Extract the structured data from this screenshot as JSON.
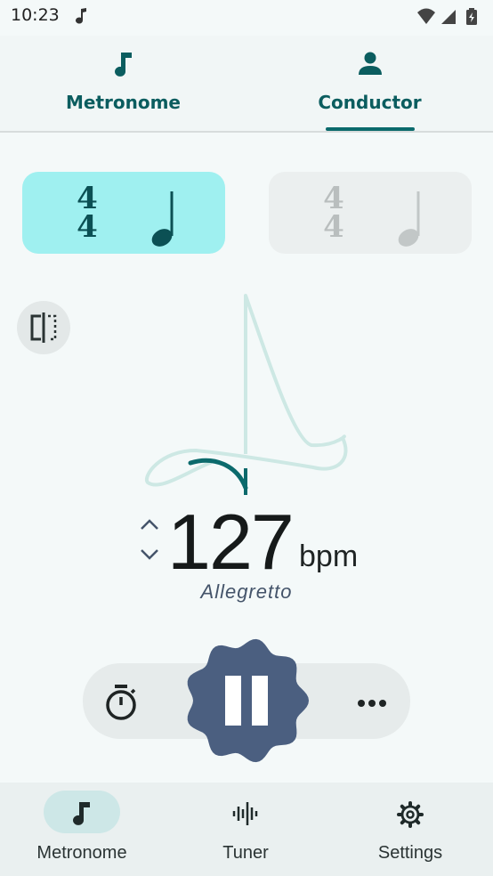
{
  "status_bar": {
    "time": "10:23"
  },
  "top_tabs": [
    {
      "label": "Metronome",
      "icon": "music-note-icon"
    },
    {
      "label": "Conductor",
      "icon": "person-icon",
      "selected": true
    }
  ],
  "time_signatures": [
    {
      "numerator": "4",
      "denominator": "4",
      "note": "quarter-note",
      "active": true
    },
    {
      "numerator": "4",
      "denominator": "4",
      "note": "quarter-note",
      "active": false
    }
  ],
  "tempo": {
    "bpm": "127",
    "unit": "bpm",
    "marking": "Allegretto"
  },
  "controls": {
    "timer_icon": "stopwatch-icon",
    "play_state": "playing",
    "more_icon": "more-horiz-icon"
  },
  "bottom_nav": [
    {
      "label": "Metronome",
      "icon": "music-note-icon",
      "selected": true
    },
    {
      "label": "Tuner",
      "icon": "waveform-icon"
    },
    {
      "label": "Settings",
      "icon": "gear-icon"
    }
  ],
  "colors": {
    "accent": "#0b6a6c",
    "active_card": "#9ff0f0",
    "play_button": "#4b5f80",
    "background": "#f4f9f9"
  }
}
